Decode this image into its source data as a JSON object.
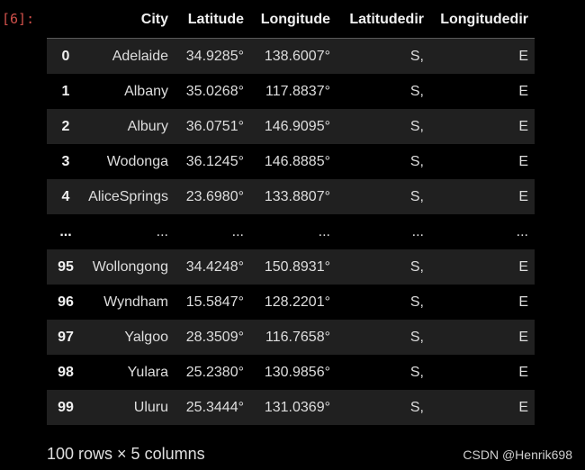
{
  "prompt": "[6]:",
  "table": {
    "columns": [
      "",
      "City",
      "Latitude",
      "Longitude",
      "Latitudedir",
      "Longitudedir"
    ],
    "rows": [
      [
        "0",
        "Adelaide",
        "34.9285°",
        "138.6007°",
        "S,",
        "E"
      ],
      [
        "1",
        "Albany",
        "35.0268°",
        "117.8837°",
        "S,",
        "E"
      ],
      [
        "2",
        "Albury",
        "36.0751°",
        "146.9095°",
        "S,",
        "E"
      ],
      [
        "3",
        "Wodonga",
        "36.1245°",
        "146.8885°",
        "S,",
        "E"
      ],
      [
        "4",
        "AliceSprings",
        "23.6980°",
        "133.8807°",
        "S,",
        "E"
      ],
      [
        "...",
        "...",
        "...",
        "...",
        "...",
        "..."
      ],
      [
        "95",
        "Wollongong",
        "34.4248°",
        "150.8931°",
        "S,",
        "E"
      ],
      [
        "96",
        "Wyndham",
        "15.5847°",
        "128.2201°",
        "S,",
        "E"
      ],
      [
        "97",
        "Yalgoo",
        "28.3509°",
        "116.7658°",
        "S,",
        "E"
      ],
      [
        "98",
        "Yulara",
        "25.2380°",
        "130.9856°",
        "S,",
        "E"
      ],
      [
        "99",
        "Uluru",
        "25.3444°",
        "131.0369°",
        "S,",
        "E"
      ]
    ]
  },
  "summary": "100 rows × 5 columns",
  "watermark": "CSDN @Henrik698"
}
